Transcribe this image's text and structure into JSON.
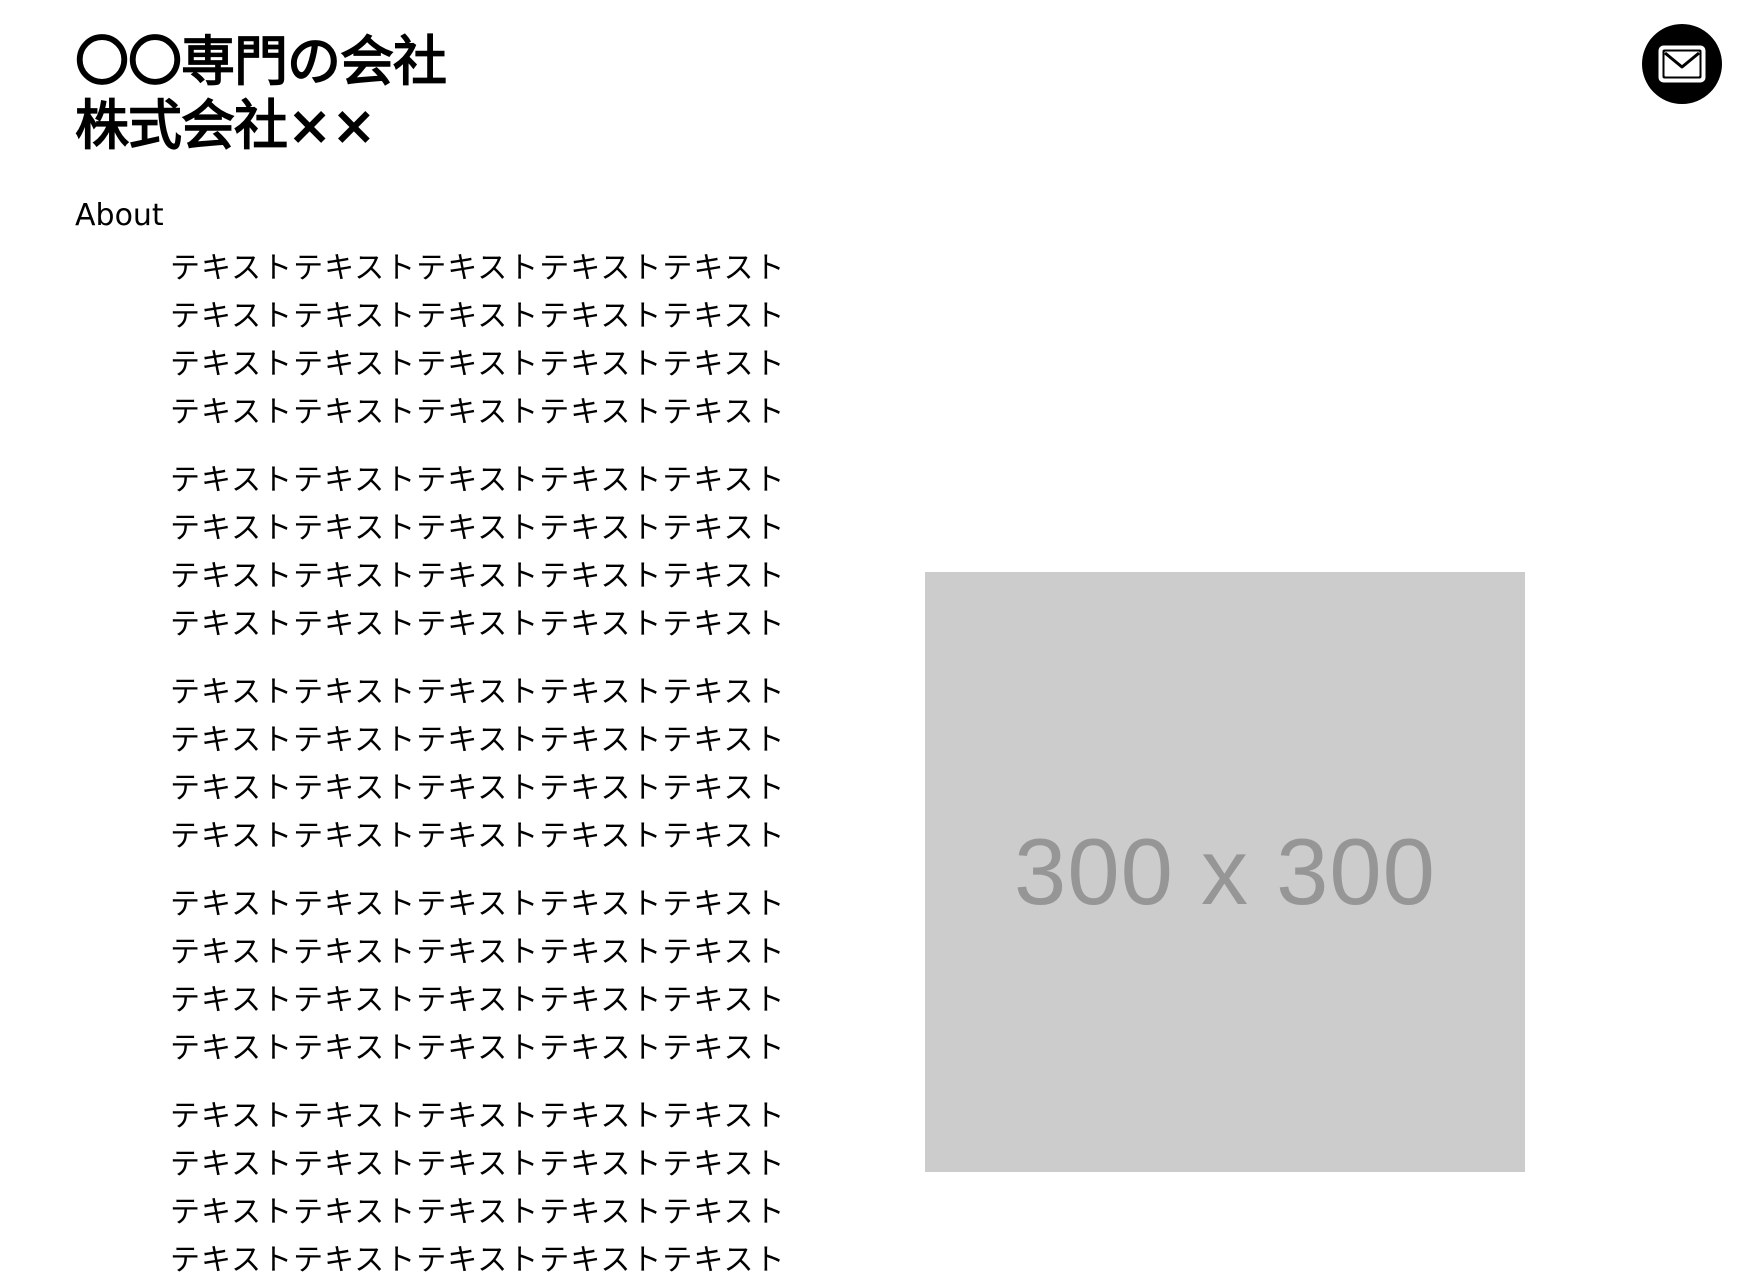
{
  "header": {
    "title_line1": "〇〇専門の会社",
    "title_line2": "株式会社××",
    "contact_icon": "mail-icon"
  },
  "nav": {
    "about_label": "About"
  },
  "about": {
    "paragraphs": [
      [
        "テキストテキストテキストテキストテキスト",
        "テキストテキストテキストテキストテキスト",
        "テキストテキストテキストテキストテキスト",
        "テキストテキストテキストテキストテキスト"
      ],
      [
        "テキストテキストテキストテキストテキスト",
        "テキストテキストテキストテキストテキスト",
        "テキストテキストテキストテキストテキスト",
        "テキストテキストテキストテキストテキスト"
      ],
      [
        "テキストテキストテキストテキストテキスト",
        "テキストテキストテキストテキストテキスト",
        "テキストテキストテキストテキストテキスト",
        "テキストテキストテキストテキストテキスト"
      ],
      [
        "テキストテキストテキストテキストテキスト",
        "テキストテキストテキストテキストテキスト",
        "テキストテキストテキストテキストテキスト",
        "テキストテキストテキストテキストテキスト"
      ],
      [
        "テキストテキストテキストテキストテキスト",
        "テキストテキストテキストテキストテキスト",
        "テキストテキストテキストテキストテキスト",
        "テキストテキストテキストテキストテキスト"
      ]
    ]
  },
  "image": {
    "placeholder_label": "300 x 300",
    "background": "#cccccc",
    "text_color": "#969696"
  }
}
